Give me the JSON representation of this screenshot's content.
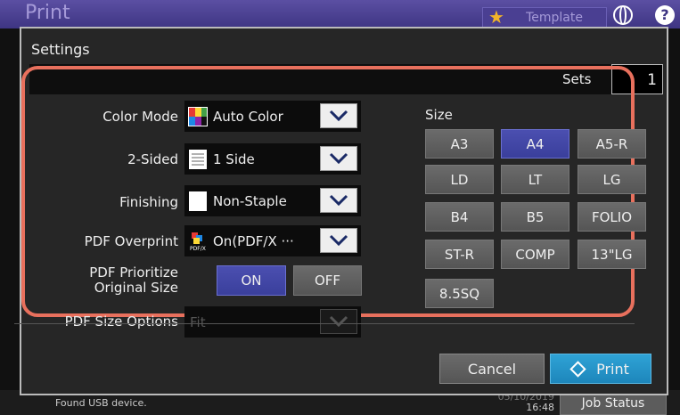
{
  "app": {
    "title": "Print",
    "template_label": "Template"
  },
  "dialog": {
    "title": "Settings",
    "sets_label": "Sets",
    "sets_value": "1"
  },
  "settings": {
    "color_mode": {
      "label": "Color Mode",
      "value": "Auto Color",
      "icon": "color-palette-icon"
    },
    "two_sided": {
      "label": "2-Sided",
      "value": "1 Side",
      "icon": "document-icon"
    },
    "finishing": {
      "label": "Finishing",
      "value": "Non-Staple",
      "icon": "blank-page-icon"
    },
    "pdf_overprint": {
      "label": "PDF Overprint",
      "value": "On(PDF/X ···",
      "icon": "pdfx-icon"
    },
    "pdf_prioritize": {
      "label_line1": "PDF Prioritize",
      "label_line2": "Original Size",
      "on_label": "ON",
      "off_label": "OFF",
      "selected": "ON"
    },
    "pdf_size_options": {
      "label": "PDF Size Options",
      "value": "Fit"
    }
  },
  "size": {
    "label": "Size",
    "selected": "A4",
    "options": [
      "A3",
      "A4",
      "A5-R",
      "LD",
      "LT",
      "LG",
      "B4",
      "B5",
      "FOLIO",
      "ST-R",
      "COMP",
      "13\"LG",
      "8.5SQ"
    ]
  },
  "footer": {
    "cancel_label": "Cancel",
    "print_label": "Print"
  },
  "status": {
    "message": "Found USB device.",
    "date": "05/10/2019",
    "time": "16:48",
    "job_status_label": "Job Status"
  },
  "colors": {
    "accent_border": "#e8705d",
    "selected": "#3a3f9c",
    "print_button": "#1d86bb"
  }
}
